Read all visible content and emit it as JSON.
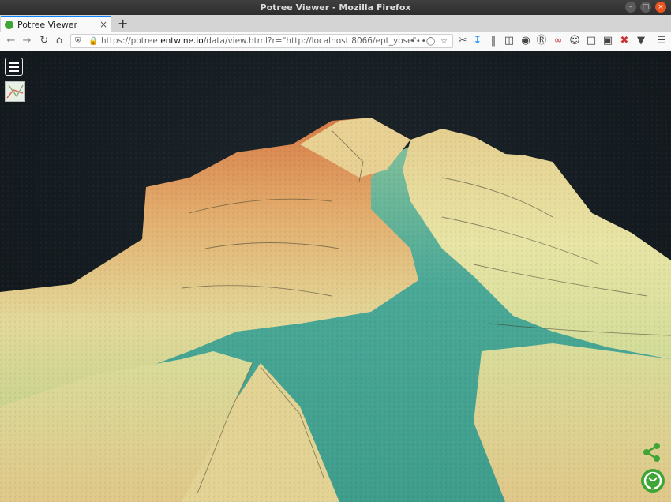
{
  "window": {
    "title": "Potree Viewer - Mozilla Firefox"
  },
  "tabs": [
    {
      "label": "Potree Viewer",
      "close": "×"
    }
  ],
  "newtab": "+",
  "url": {
    "prefix": "https://potree.",
    "host": "entwine.io",
    "path": "/data/view.html?r=\"http://localhost:8066/ept_yose\""
  },
  "icons": {
    "back": "back-arrow-icon",
    "forward": "forward-arrow-icon",
    "reload": "reload-icon",
    "home": "home-icon",
    "menu": "hamburger-menu-icon",
    "share": "share-icon",
    "logo": "potree-logo-icon"
  },
  "colors": {
    "tab_accent": "#0a84ff",
    "viewer_bg": "#151b20",
    "terrain_high": "#d77a45",
    "terrain_mid": "#e3d99a",
    "terrain_low": "#4aa897",
    "share_green": "#3fa535"
  }
}
